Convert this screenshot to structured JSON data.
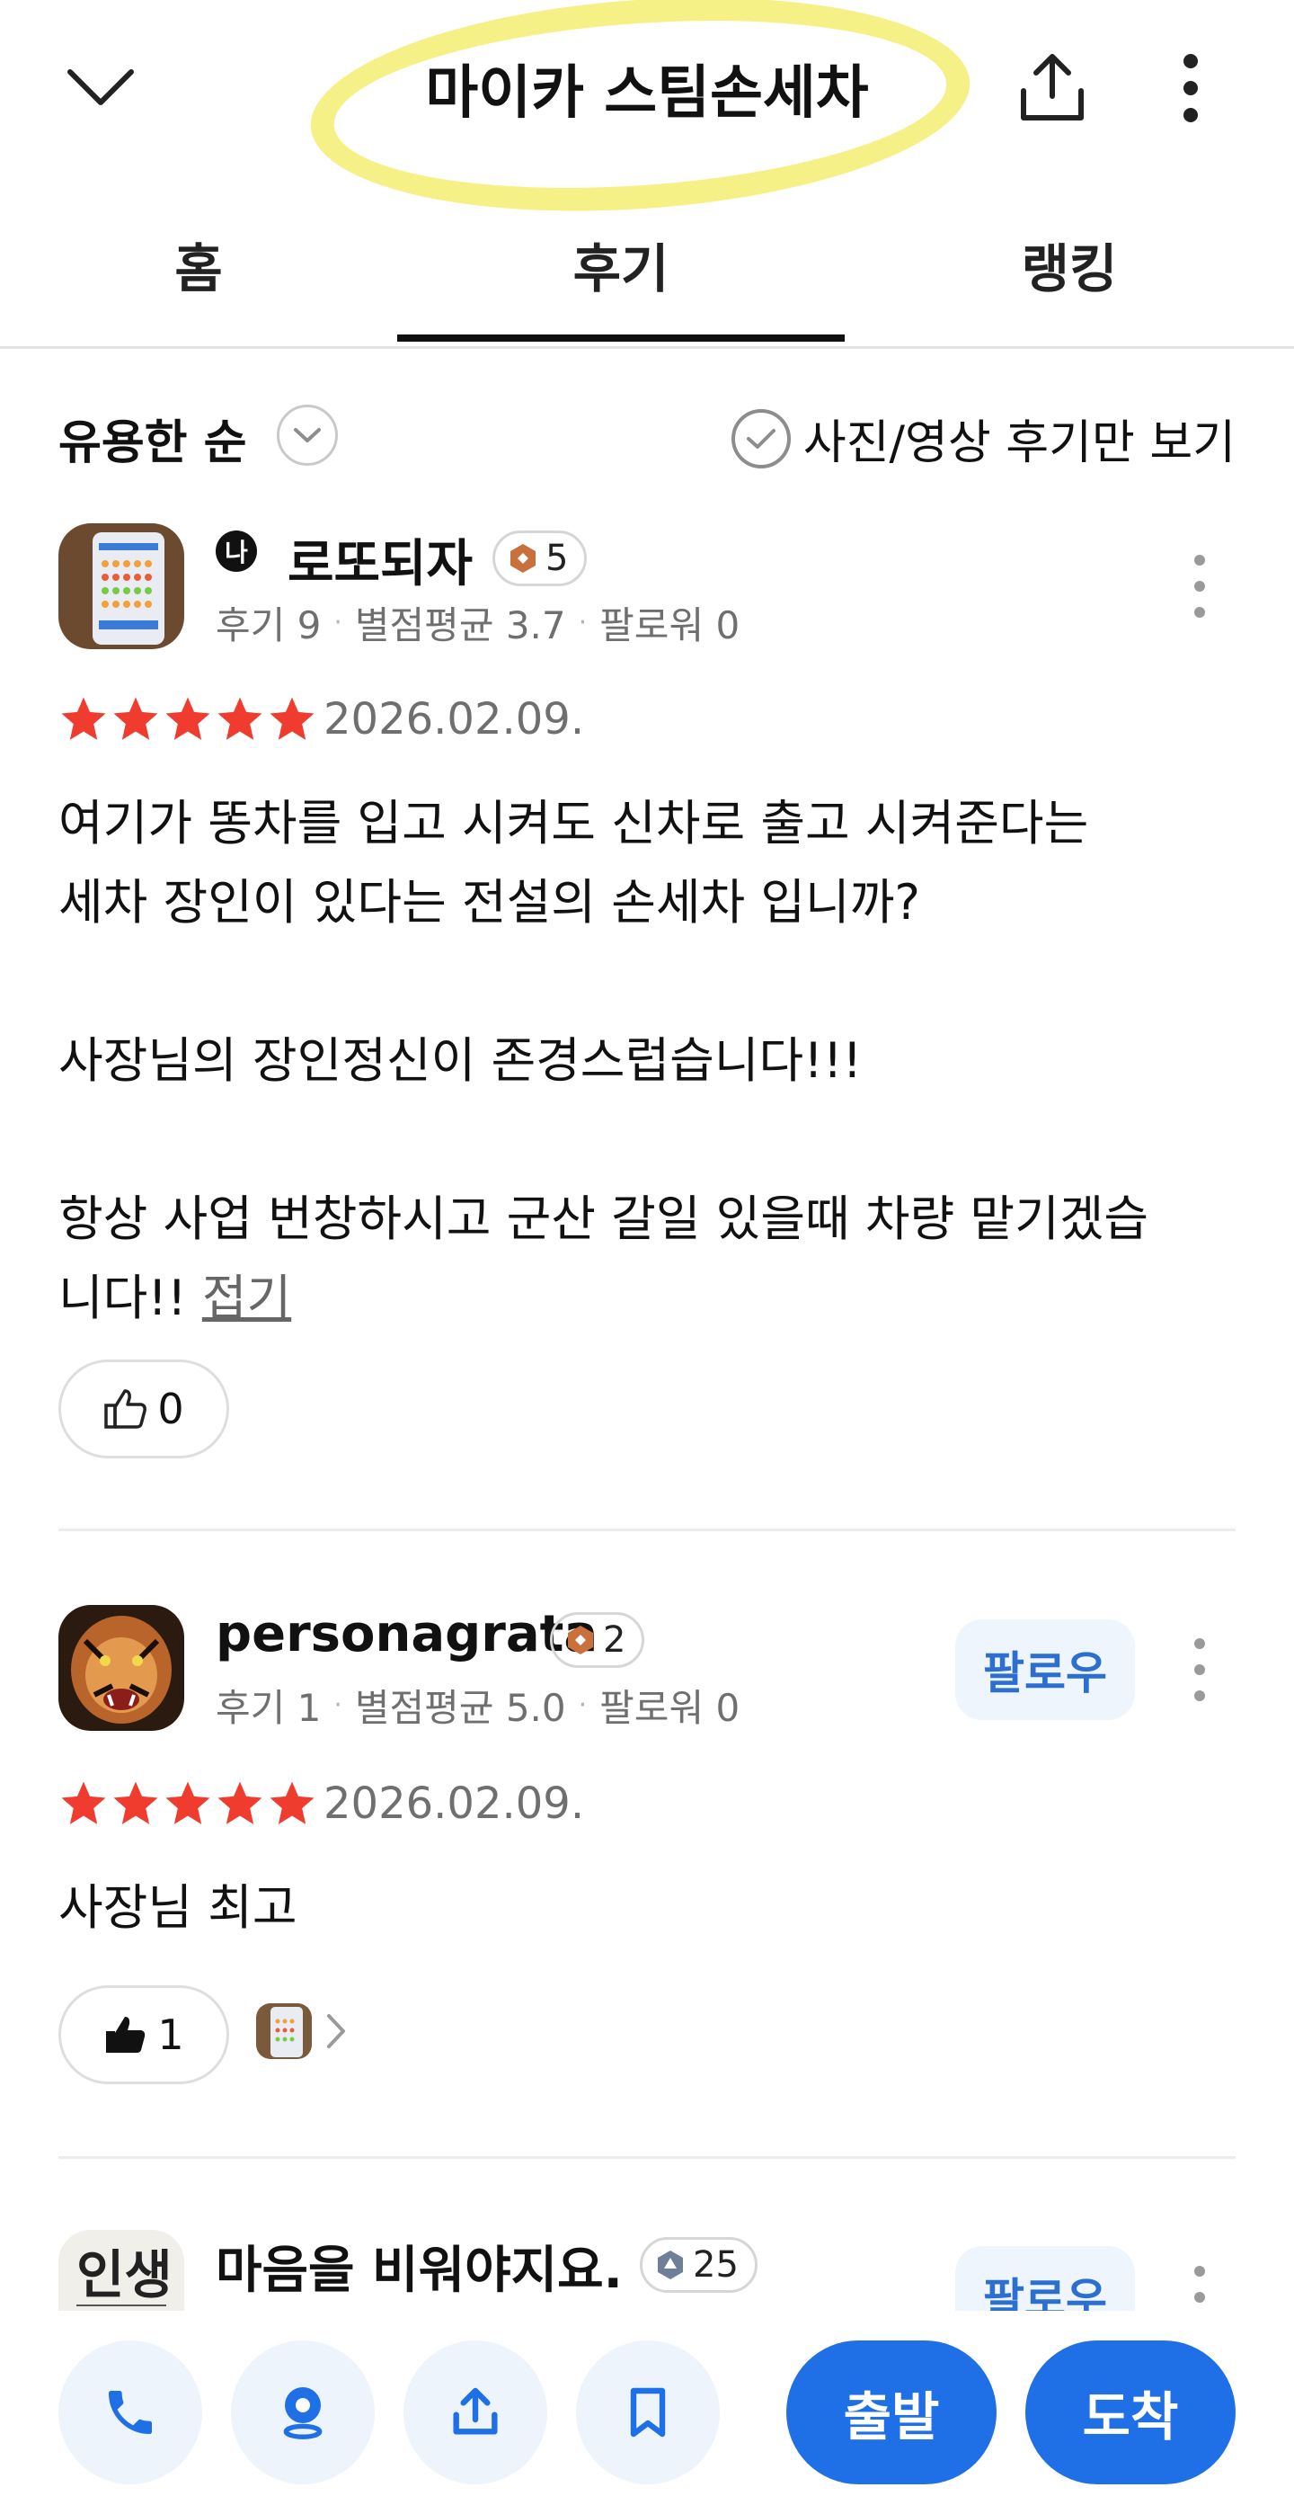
{
  "header": {
    "title": "마이카 스팀손세차",
    "back_icon": "chevron-down-icon",
    "share_icon": "share-icon",
    "more_icon": "more-vertical-icon"
  },
  "tabs": [
    {
      "label": "홈",
      "active": false
    },
    {
      "label": "후기",
      "active": true
    },
    {
      "label": "랭킹",
      "active": false
    }
  ],
  "sort": {
    "label": "유용한 순"
  },
  "filter": {
    "label": "사진/영상 후기만 보기"
  },
  "reviews": [
    {
      "user": "로또되자",
      "badge_level": "5",
      "meta": {
        "reviews": "후기 9",
        "avg": "별점평균 3.7",
        "followers": "팔로워 0"
      },
      "rating": 5,
      "date": "2026.02.09.",
      "text": "여기가 똥차를 입고 시켜도 신차로 출고 시켜준다는\n세차 장인이 있다는 전설의 손세차 입니까?\n\n사장님의 장인정신이 존경스럽습니다!!!\n\n항상 사업 번창하시고 군산 갈일 있을때 차량 맡기겠습\n니다!!",
      "fold_label": "접기",
      "likes": "0"
    },
    {
      "user": "personagrata",
      "badge_level": "2",
      "meta": {
        "reviews": "후기 1",
        "avg": "별점평균 5.0",
        "followers": "팔로워 0"
      },
      "follow_label": "팔로우",
      "rating": 5,
      "date": "2026.02.09.",
      "text": "사장님 최고",
      "likes": "1"
    },
    {
      "user": "마음을 비워야지요.",
      "badge_level": "25",
      "follow_label": "팔로우"
    }
  ],
  "bottom_bar": {
    "depart_label": "출발",
    "arrive_label": "도착"
  },
  "colors": {
    "star": "#f03c2e",
    "accent_blue": "#1f6fe6",
    "highlight": "#f4f07a"
  }
}
